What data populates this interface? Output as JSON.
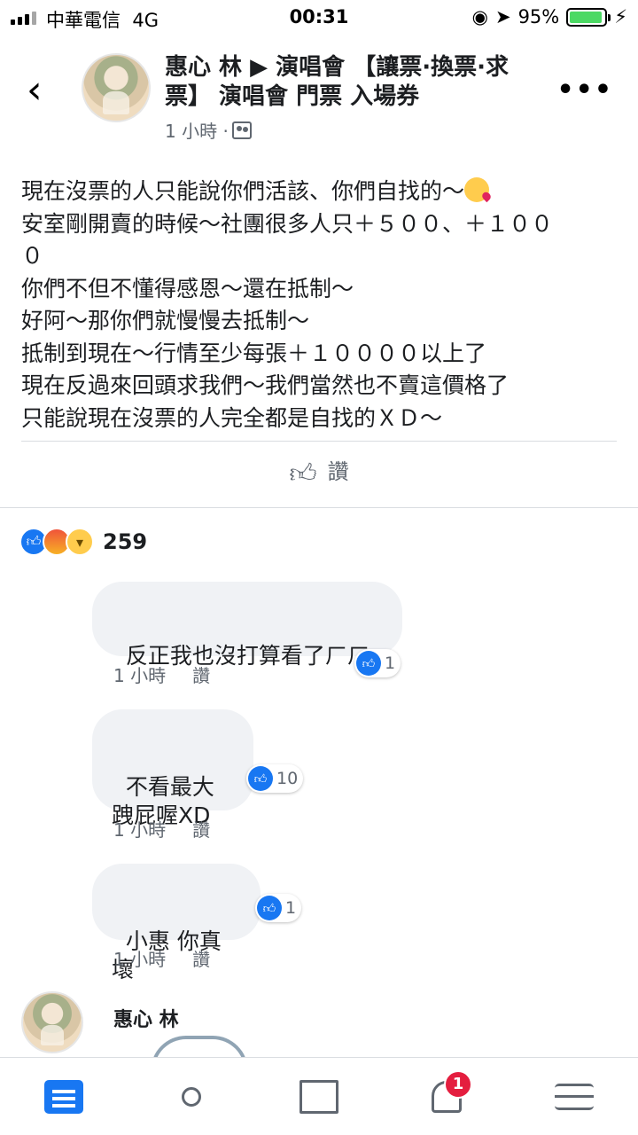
{
  "status_bar": {
    "carrier": "中華電信",
    "network": "4G",
    "time": "00:31",
    "battery": "95%",
    "battery_level": 0.95
  },
  "header": {
    "title": "惠心 林 ▶ 演唱會 【讓票·換票·求票】 演唱會 門票 入場券",
    "time": "1 小時 ·",
    "back_icon": "chevron-left-icon",
    "more_icon": "more-dots-icon"
  },
  "post": {
    "lines": [
      "現在沒票的人只能說你們活該、你們自找的～",
      "安室剛開賣的時候～社團很多人只＋５００、＋１００",
      "０",
      "你們不但不懂得感恩～還在抵制～",
      "好阿～那你們就慢慢去抵制～",
      "抵制到現在～行情至少每張＋１００００以上了",
      "現在反過來回頭求我們～我們當然也不賣這價格了",
      "只能說現在沒票的人完全都是自找的ＸＤ～"
    ],
    "emoji": "kissing-heart-emoji"
  },
  "like_button": {
    "label": "讚",
    "icon": "thumbs-up-icon"
  },
  "reactions": {
    "count": "259",
    "types": [
      "like",
      "angry",
      "haha"
    ]
  },
  "comments": [
    {
      "text": "反正我也沒打算看了ㄏㄏ",
      "time": "1 小時",
      "like": "讚",
      "reactions": "1"
    },
    {
      "text": "不看最大\n跩屁喔XD",
      "time": "1 小時",
      "like": "讚",
      "reactions": "10"
    },
    {
      "text": "小惠 你真壞",
      "time": "1 小時",
      "like": "讚",
      "reactions": "1"
    },
    {
      "name": "惠心 林"
    }
  ],
  "nav": {
    "tabs": [
      "news-feed",
      "friends",
      "marketplace",
      "notifications",
      "menu"
    ],
    "notifications_badge": "1"
  },
  "colors": {
    "accent": "#1877f2",
    "badge": "#e41e3f",
    "bubble": "#f0f2f5",
    "battery": "#4cd964"
  }
}
